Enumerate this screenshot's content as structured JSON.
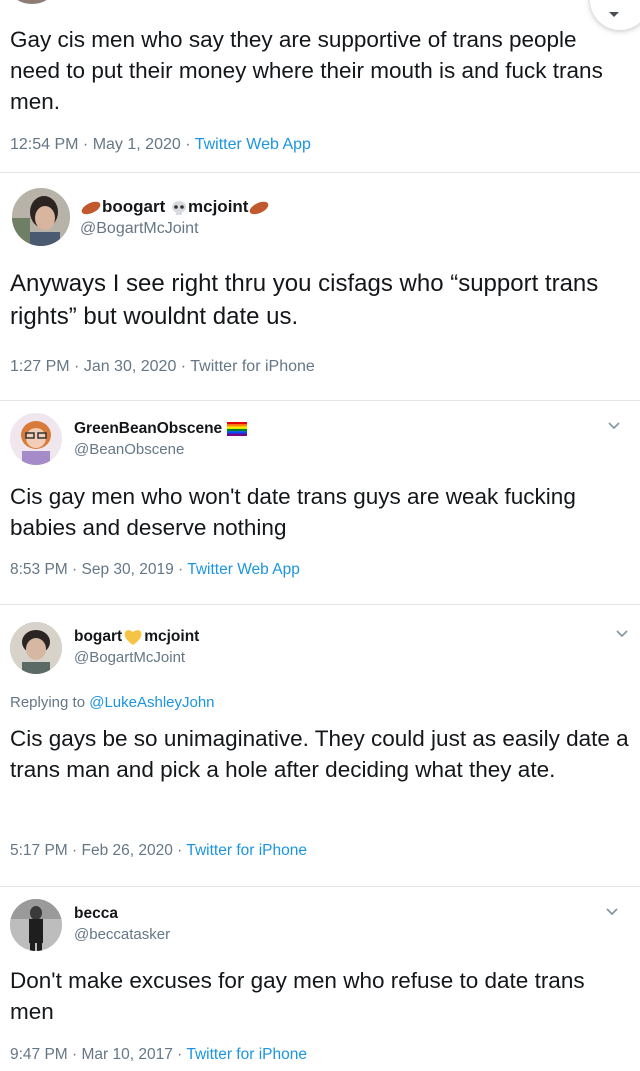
{
  "tweets": [
    {
      "text": "Gay cis men who say they are supportive of trans people need to put their money where their mouth is and fuck trans men.",
      "time": "12:54 PM",
      "date": "May 1, 2020",
      "source": "Twitter Web App"
    },
    {
      "display_name_a": "boogart",
      "display_name_b": "mcjoint",
      "handle": "@BogartMcJoint",
      "text": "Anyways I see right thru you cisfags who “support trans rights” but wouldnt date us.",
      "time": "1:27 PM",
      "date": "Jan 30, 2020",
      "source": "Twitter for iPhone"
    },
    {
      "display_name": "GreenBeanObscene",
      "handle": "@BeanObscene",
      "text": "Cis gay men who won't date trans guys are weak fucking babies and deserve nothing",
      "time": "8:53 PM",
      "date": "Sep 30, 2019",
      "source": "Twitter Web App"
    },
    {
      "display_name_a": "bogart",
      "display_name_b": "mcjoint",
      "handle": "@BogartMcJoint",
      "replying_prefix": "Replying to ",
      "replying_to": "@LukeAshleyJohn",
      "text": "Cis gays be so unimaginative. They could just as easily date a trans man and pick a hole after deciding what they ate.",
      "time": "5:17 PM",
      "date": "Feb 26, 2020",
      "source": "Twitter for iPhone"
    },
    {
      "display_name": "becca",
      "handle": "@beccatasker",
      "text": "Don't make excuses for gay men who refuse to date trans men",
      "time": "9:47 PM",
      "date": "Mar 10, 2017",
      "source": "Twitter for iPhone"
    }
  ],
  "separator": " · ",
  "icons": {
    "chevron": "chevron-down-icon",
    "sausage": "sausage-emoji-icon",
    "skull": "skull-emoji-icon",
    "heart": "yellow-heart-emoji-icon",
    "rainbow_flag": "rainbow-flag-emoji-icon"
  },
  "colors": {
    "link": "#1b95e0",
    "secondary_text": "#657786",
    "primary_text": "#14171a",
    "divider": "#e3e6e8"
  }
}
